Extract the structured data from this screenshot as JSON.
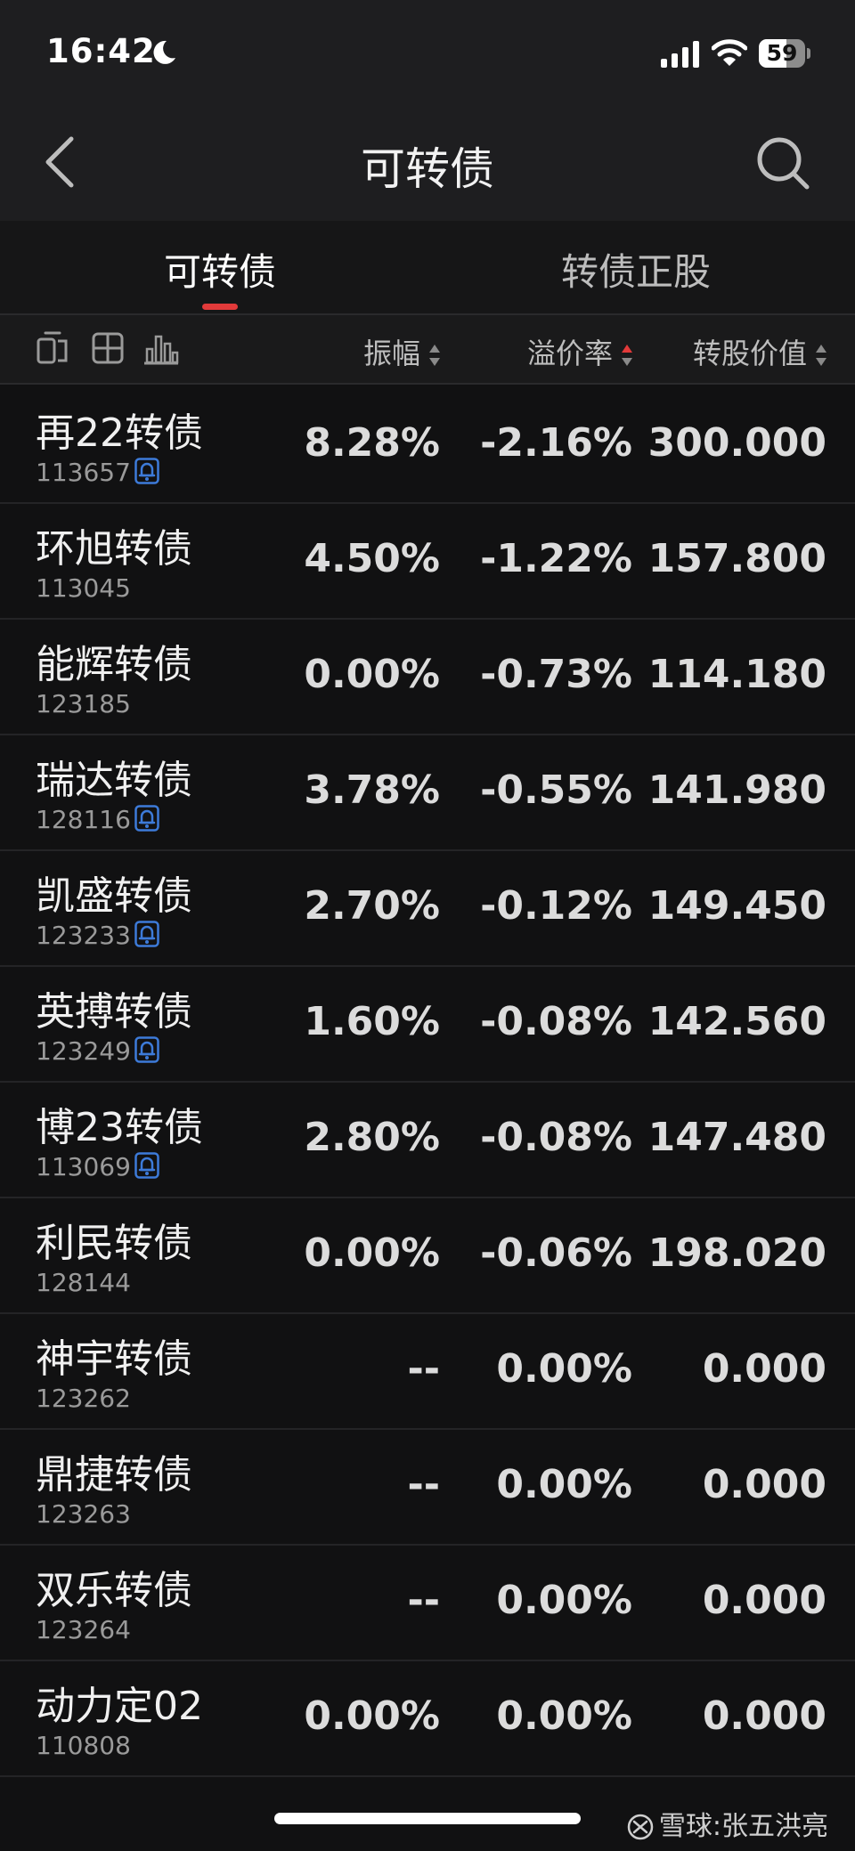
{
  "status_bar": {
    "time": "16:42",
    "battery": "59",
    "battery_level": 0.59
  },
  "nav": {
    "title": "可转债"
  },
  "tabs": [
    {
      "label": "可转债",
      "active": true
    },
    {
      "label": "转债正股",
      "active": false
    }
  ],
  "columns": {
    "amplitude": "振幅",
    "premium_rate": "溢价率",
    "conversion_value": "转股价值",
    "sorted_column": "premium_rate",
    "sort_direction": "ascending"
  },
  "bonds": [
    {
      "name": "再22转债",
      "code": "113657",
      "alert": true,
      "amplitude": "8.28%",
      "premium": "-2.16%",
      "value": "300.000"
    },
    {
      "name": "环旭转债",
      "code": "113045",
      "alert": false,
      "amplitude": "4.50%",
      "premium": "-1.22%",
      "value": "157.800"
    },
    {
      "name": "能辉转债",
      "code": "123185",
      "alert": false,
      "amplitude": "0.00%",
      "premium": "-0.73%",
      "value": "114.180"
    },
    {
      "name": "瑞达转债",
      "code": "128116",
      "alert": true,
      "amplitude": "3.78%",
      "premium": "-0.55%",
      "value": "141.980"
    },
    {
      "name": "凯盛转债",
      "code": "123233",
      "alert": true,
      "amplitude": "2.70%",
      "premium": "-0.12%",
      "value": "149.450"
    },
    {
      "name": "英搏转债",
      "code": "123249",
      "alert": true,
      "amplitude": "1.60%",
      "premium": "-0.08%",
      "value": "142.560"
    },
    {
      "name": "博23转债",
      "code": "113069",
      "alert": true,
      "amplitude": "2.80%",
      "premium": "-0.08%",
      "value": "147.480"
    },
    {
      "name": "利民转债",
      "code": "128144",
      "alert": false,
      "amplitude": "0.00%",
      "premium": "-0.06%",
      "value": "198.020"
    },
    {
      "name": "神宇转债",
      "code": "123262",
      "alert": false,
      "amplitude": "--",
      "premium": "0.00%",
      "value": "0.000"
    },
    {
      "name": "鼎捷转债",
      "code": "123263",
      "alert": false,
      "amplitude": "--",
      "premium": "0.00%",
      "value": "0.000"
    },
    {
      "name": "双乐转债",
      "code": "123264",
      "alert": false,
      "amplitude": "--",
      "premium": "0.00%",
      "value": "0.000"
    },
    {
      "name": "动力定02",
      "code": "110808",
      "alert": false,
      "amplitude": "0.00%",
      "premium": "0.00%",
      "value": "0.000"
    }
  ],
  "watermark": {
    "brand": "雪球",
    "separator": ":",
    "author": "张五洪亮"
  },
  "colors": {
    "background": "#111112",
    "header_background": "#1e1e20",
    "accent_red": "#e23a3a",
    "alert_blue": "#3d7bd9"
  }
}
